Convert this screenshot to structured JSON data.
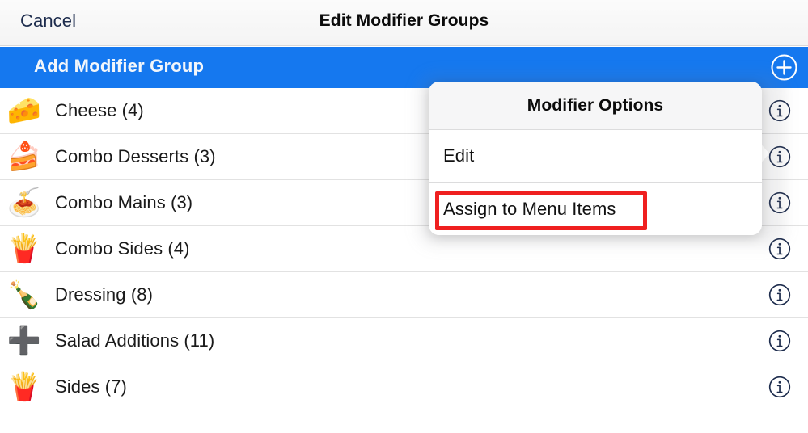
{
  "navbar": {
    "cancel_label": "Cancel",
    "title": "Edit Modifier Groups"
  },
  "add_bar": {
    "label": "Add Modifier Group",
    "add_icon": "plus-circle-icon",
    "background_color": "#1578ef"
  },
  "list": {
    "rows": [
      {
        "emoji": "🧀",
        "icon_name": "cheese-wedge-icon",
        "label": "Cheese (4)",
        "count": 4,
        "info_icon": "info-circle-icon"
      },
      {
        "emoji": "🍰",
        "icon_name": "cake-slice-icon",
        "label": "Combo Desserts (3)",
        "count": 3,
        "info_icon": "info-circle-icon"
      },
      {
        "emoji": "🍝",
        "icon_name": "spaghetti-icon",
        "label": "Combo Mains (3)",
        "count": 3,
        "info_icon": "info-circle-icon"
      },
      {
        "emoji": "🍟",
        "icon_name": "french-fries-icon",
        "label": "Combo Sides (4)",
        "count": 4,
        "info_icon": "info-circle-icon"
      },
      {
        "emoji": "🍾",
        "icon_name": "bottle-icon",
        "label": "Dressing (8)",
        "count": 8,
        "info_icon": "info-circle-icon"
      },
      {
        "emoji": "➕",
        "icon_name": "plus-sign-icon",
        "label": "Salad Additions (11)",
        "count": 11,
        "info_icon": "info-circle-icon"
      },
      {
        "emoji": "🍟",
        "icon_name": "french-fries-icon",
        "label": "Sides (7)",
        "count": 7,
        "info_icon": "info-circle-icon"
      }
    ]
  },
  "popup": {
    "title": "Modifier Options",
    "items": [
      {
        "label": "Edit",
        "highlighted": false
      },
      {
        "label": "Assign to Menu Items",
        "highlighted": true
      }
    ]
  },
  "highlight": {
    "color": "#ef2020",
    "target": "Assign to Menu Items"
  },
  "colors": {
    "accent_blue": "#1578ef",
    "nav_text": "#1d2c4d",
    "info_icon": "#1d2c4d",
    "highlight_red": "#ef2020"
  }
}
